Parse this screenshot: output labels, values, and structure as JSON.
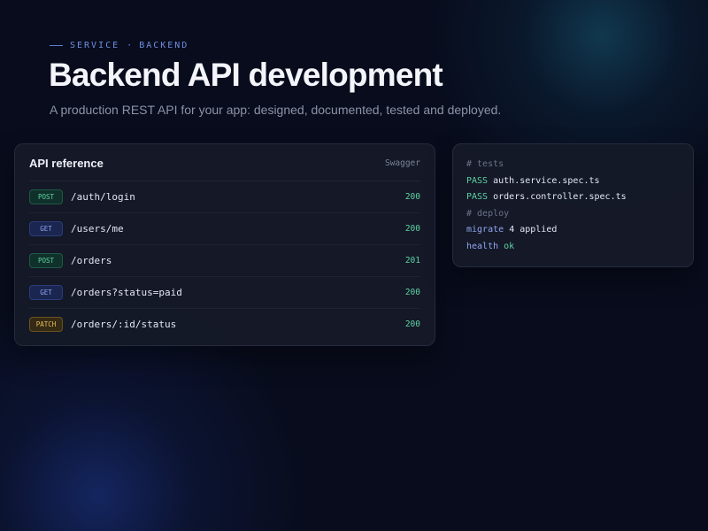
{
  "hero": {
    "eyebrow": {
      "part1": "SERVICE",
      "separator": "·",
      "part2": "BACKEND"
    },
    "title": "Backend API development",
    "subtitle": "A production REST API for your app: designed, documented, tested and deployed."
  },
  "api_card": {
    "title": "API reference",
    "swagger_label": "Swagger",
    "endpoints": [
      {
        "method": "POST",
        "path": "/auth/login",
        "status": "200"
      },
      {
        "method": "GET",
        "path": "/users/me",
        "status": "200"
      },
      {
        "method": "POST",
        "path": "/orders",
        "status": "201"
      },
      {
        "method": "GET",
        "path": "/orders?status=paid",
        "status": "200"
      },
      {
        "method": "PATCH",
        "path": "/orders/:id/status",
        "status": "200"
      }
    ]
  },
  "terminal": {
    "tests_comment": "# tests",
    "pass1_label": "PASS",
    "pass1_file": "auth.service.spec.ts",
    "pass2_label": "PASS",
    "pass2_file": "orders.controller.spec.ts",
    "deploy_comment": "# deploy",
    "migrate_cmd": "migrate",
    "migrate_result": "4 applied",
    "health_cmd": "health",
    "health_result": "ok"
  },
  "colors": {
    "background": "#080c1c",
    "accent_blue": "#6f8de0",
    "status_green": "#5fd3a2",
    "get_blue": "#8fa6ee",
    "patch_amber": "#e6bb5a"
  }
}
